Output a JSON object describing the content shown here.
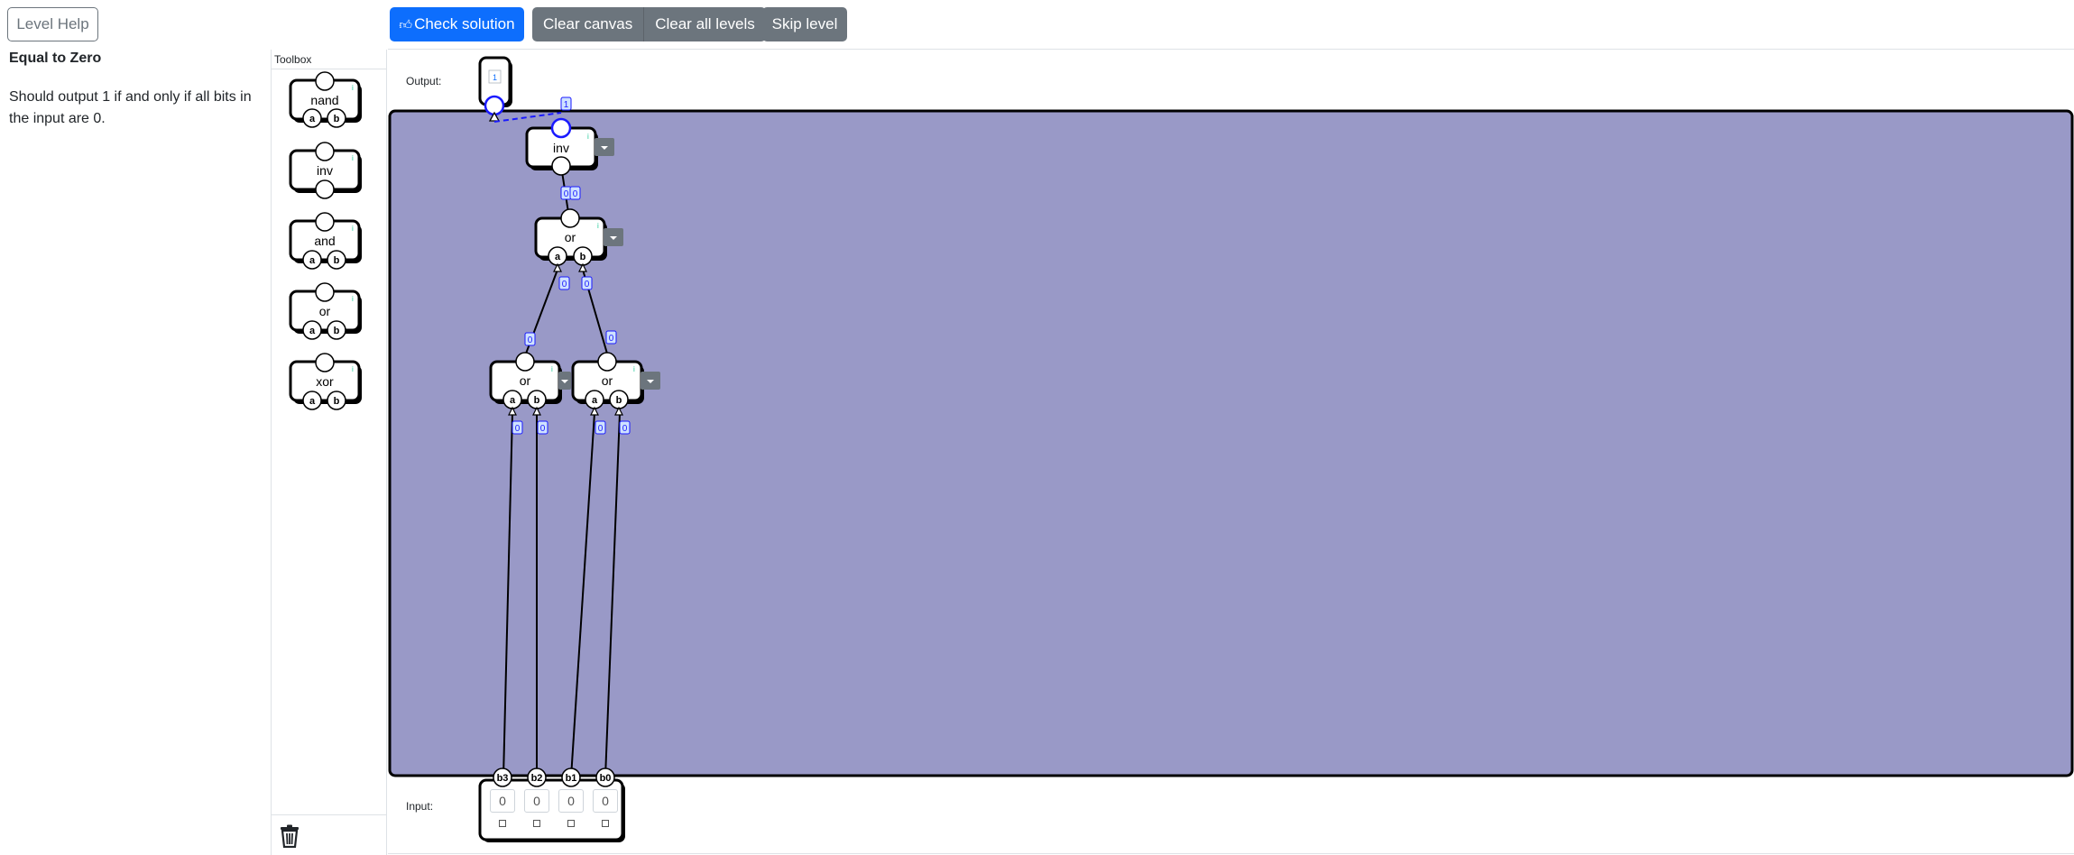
{
  "header": {
    "level_help": "Level Help",
    "check_solution": "Check solution",
    "clear_canvas": "Clear canvas",
    "clear_all_levels": "Clear all levels",
    "skip_level": "Skip level"
  },
  "level": {
    "title": "Equal to Zero",
    "description": "Should output 1 if and only if all bits in the input are 0."
  },
  "toolbox": {
    "title": "Toolbox",
    "gates": [
      {
        "label": "nand",
        "pins": [
          "a",
          "b"
        ]
      },
      {
        "label": "inv",
        "pins": []
      },
      {
        "label": "and",
        "pins": [
          "a",
          "b"
        ]
      },
      {
        "label": "or",
        "pins": [
          "a",
          "b"
        ]
      },
      {
        "label": "xor",
        "pins": [
          "a",
          "b"
        ]
      }
    ]
  },
  "canvas": {
    "output_label": "Output:",
    "input_label": "Input:",
    "background_color": "#9999c7",
    "output_value": "1",
    "gates": {
      "inv": {
        "label": "inv",
        "out_value": "1",
        "in_value": "0"
      },
      "or_top": {
        "label": "or",
        "out_value": "0",
        "a_value": "0",
        "b_value": "0"
      },
      "or_left": {
        "label": "or",
        "out_value": "0",
        "a_value": "0",
        "b_value": "0"
      },
      "or_right": {
        "label": "or",
        "out_value": "0",
        "a_value": "0",
        "b_value": "0"
      }
    },
    "inputs": [
      {
        "pin": "b3",
        "value": "0"
      },
      {
        "pin": "b2",
        "value": "0"
      },
      {
        "pin": "b1",
        "value": "0"
      },
      {
        "pin": "b0",
        "value": "0"
      }
    ]
  },
  "colors": {
    "primary": "#0d6efd",
    "secondary": "#6c757d",
    "wire_value_bg": "#cfe2ff",
    "selected_wire": "#1a1aff"
  },
  "icons": {
    "check_button_icon": "thumbs-up-icon",
    "trash": "trash-icon",
    "gate_menu": "caret-down-icon"
  }
}
